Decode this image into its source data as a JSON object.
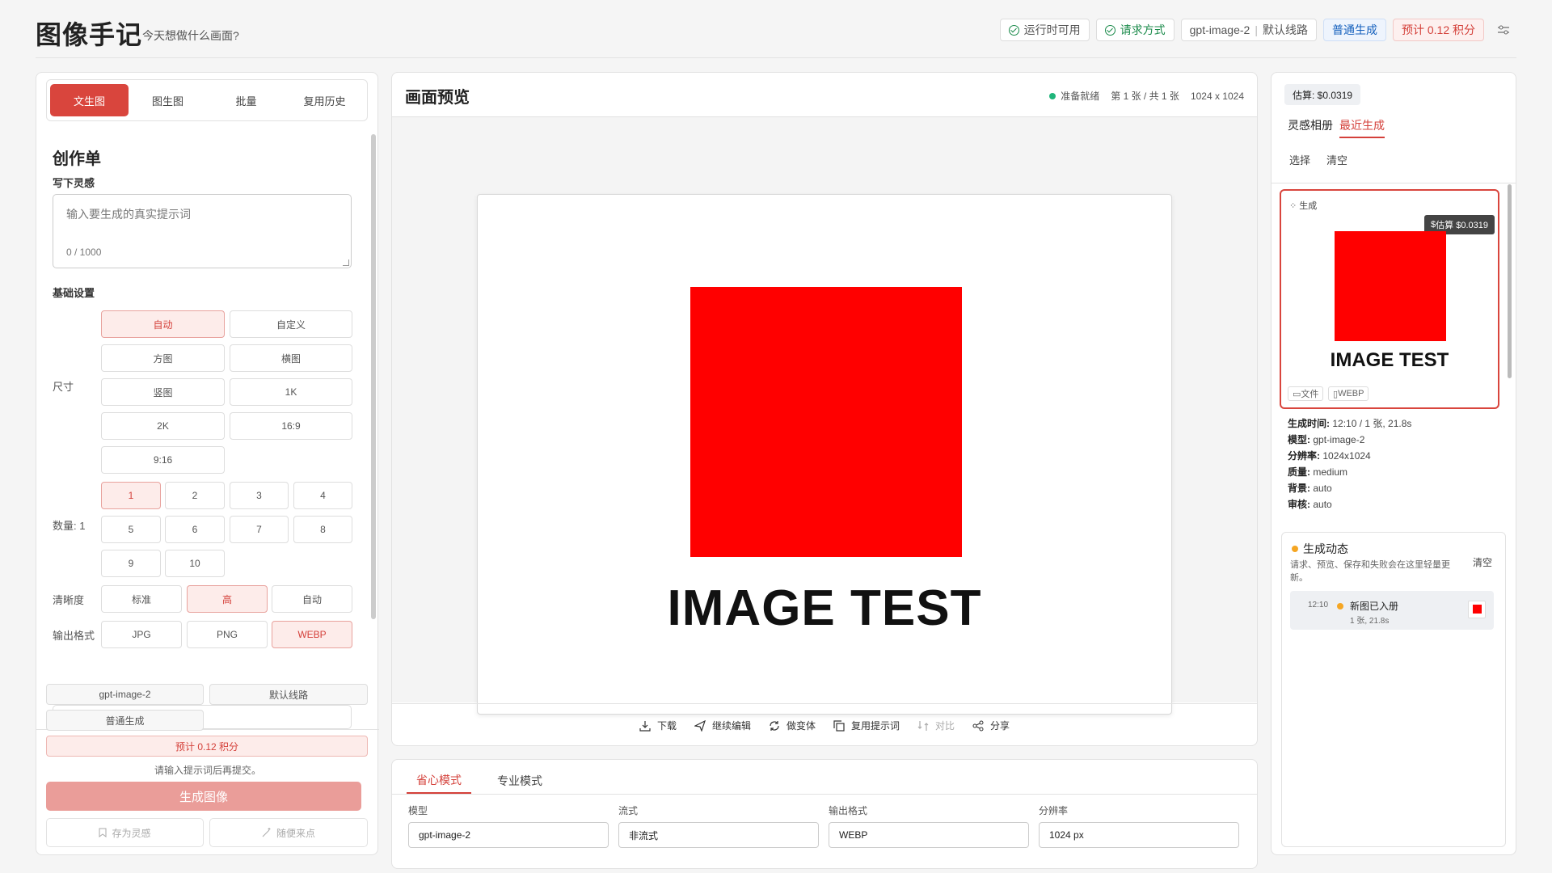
{
  "app": {
    "title": "图像手记",
    "subtitle": "今天想做什么画面?"
  },
  "topbar": {
    "runtime": "运行时可用",
    "request_mode": "请求方式",
    "model": "gpt-image-2",
    "route": "默认线路",
    "gen_mode": "普通生成",
    "estimate": "预计 0.12 积分"
  },
  "left": {
    "tabs": [
      "文生图",
      "图生图",
      "批量",
      "复用历史"
    ],
    "heading": "创作单",
    "prompt_label": "写下灵感",
    "prompt_placeholder": "输入要生成的真实提示词",
    "prompt_count": "0 / 1000",
    "basic_label": "基础设置",
    "size_label": "尺寸",
    "sizes": [
      "自动",
      "自定义",
      "方图",
      "横图",
      "竖图",
      "1K",
      "2K",
      "16:9",
      "9:16"
    ],
    "qty_label": "数量: 1",
    "qtys": [
      "1",
      "2",
      "3",
      "4",
      "5",
      "6",
      "7",
      "8",
      "9",
      "10"
    ],
    "clarity_label": "清晰度",
    "clarity": [
      "标准",
      "高",
      "自动"
    ],
    "format_label": "输出格式",
    "formats": [
      "JPG",
      "PNG",
      "WEBP"
    ],
    "footer": {
      "model": "gpt-image-2",
      "route": "默认线路",
      "gen_mode": "普通生成",
      "estimate": "预计 0.12 积分",
      "hint": "请输入提示词后再提交。",
      "generate": "生成图像",
      "save": "存为灵感",
      "random": "随便来点"
    }
  },
  "preview": {
    "title": "画面预览",
    "status": "准备就绪",
    "page": "第 1 张 / 共 1 张",
    "dims": "1024 x 1024",
    "image_text": "IMAGE TEST",
    "image_color": "#ff0000",
    "actions": [
      "下载",
      "继续编辑",
      "做变体",
      "复用提示词",
      "对比",
      "分享"
    ]
  },
  "bottom": {
    "tabs": [
      "省心模式",
      "专业模式"
    ],
    "fields": [
      {
        "label": "模型",
        "value": "gpt-image-2"
      },
      {
        "label": "流式",
        "value": "非流式"
      },
      {
        "label": "输出格式",
        "value": "WEBP"
      },
      {
        "label": "分辨率",
        "value": "1024 px"
      }
    ]
  },
  "right": {
    "estimate": "估算: $0.0319",
    "tabs": [
      "灵感相册",
      "最近生成"
    ],
    "links": [
      "选择",
      "清空"
    ],
    "card": {
      "label": "生成",
      "badge": "估算 $0.0319",
      "text": "IMAGE TEST",
      "chip1": "文件",
      "chip2": "WEBP"
    },
    "meta": [
      {
        "k": "生成时间:",
        "v": "12:10 / 1 张, 21.8s"
      },
      {
        "k": "模型:",
        "v": "gpt-image-2"
      },
      {
        "k": "分辨率:",
        "v": "1024x1024"
      },
      {
        "k": "质量:",
        "v": "medium"
      },
      {
        "k": "背景:",
        "v": "auto"
      },
      {
        "k": "审核:",
        "v": "auto"
      }
    ],
    "activity": {
      "title": "生成动态",
      "desc": "请求、预览、保存和失败会在这里轻量更新。",
      "clear": "清空",
      "time": "12:10",
      "event": "新图已入册",
      "detail": "1 张, 21.8s"
    }
  },
  "colors": {
    "accent": "#d9453d",
    "ready": "#1fb57a",
    "activity": "#f5a623"
  }
}
